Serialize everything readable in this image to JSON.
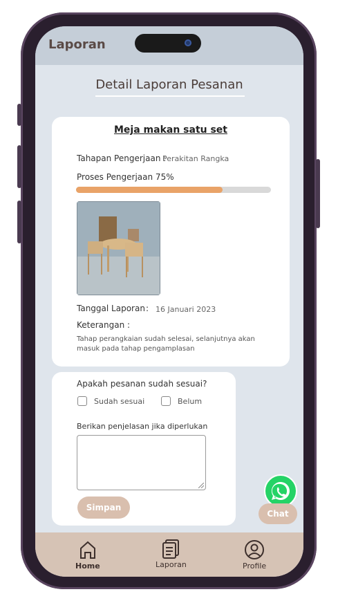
{
  "app": {
    "title": "Laporan"
  },
  "page": {
    "title": "Detail Laporan Pesanan"
  },
  "report": {
    "order_name": "Meja makan satu set",
    "stage_label": "Tahapan Pengerjaan :",
    "stage_value": "Perakitan Rangka",
    "progress_label": "Proses Pengerjaan 75%",
    "progress": 0.75,
    "date_label": "Tanggal Laporan",
    "date_sep": ":",
    "date_value": "16 Januari 2023",
    "note_label": "Keterangan :",
    "note_text": "Tahap perangkaian sudah selesai, selanjutnya akan masuk pada tahap pengamplasan"
  },
  "feedback": {
    "question": "Apakah pesanan sudah sesuai?",
    "option_yes": "Sudah sesuai",
    "option_no": "Belum",
    "explain_label": "Berikan penjelasan jika diperlukan",
    "explain_value": "",
    "save_label": "Simpan"
  },
  "chat": {
    "label": "Chat",
    "icon": "whatsapp-icon"
  },
  "nav": {
    "home": "Home",
    "report": "Laporan",
    "profile": "Profile"
  },
  "colors": {
    "progress": "#e9a368",
    "accent_button": "#d9bfae",
    "nav_bg": "#d6c3b5",
    "whatsapp": "#25d366"
  }
}
